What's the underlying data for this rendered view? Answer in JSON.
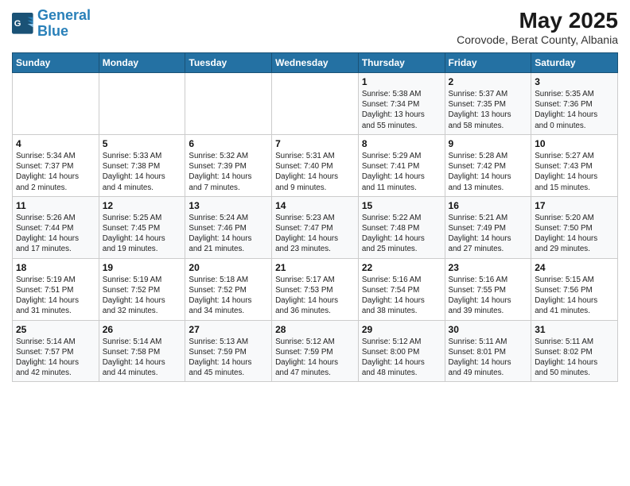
{
  "logo": {
    "line1": "General",
    "line2": "Blue"
  },
  "title": "May 2025",
  "subtitle": "Corovode, Berat County, Albania",
  "days_of_week": [
    "Sunday",
    "Monday",
    "Tuesday",
    "Wednesday",
    "Thursday",
    "Friday",
    "Saturday"
  ],
  "weeks": [
    [
      {
        "day": "",
        "info": ""
      },
      {
        "day": "",
        "info": ""
      },
      {
        "day": "",
        "info": ""
      },
      {
        "day": "",
        "info": ""
      },
      {
        "day": "1",
        "info": "Sunrise: 5:38 AM\nSunset: 7:34 PM\nDaylight: 13 hours\nand 55 minutes."
      },
      {
        "day": "2",
        "info": "Sunrise: 5:37 AM\nSunset: 7:35 PM\nDaylight: 13 hours\nand 58 minutes."
      },
      {
        "day": "3",
        "info": "Sunrise: 5:35 AM\nSunset: 7:36 PM\nDaylight: 14 hours\nand 0 minutes."
      }
    ],
    [
      {
        "day": "4",
        "info": "Sunrise: 5:34 AM\nSunset: 7:37 PM\nDaylight: 14 hours\nand 2 minutes."
      },
      {
        "day": "5",
        "info": "Sunrise: 5:33 AM\nSunset: 7:38 PM\nDaylight: 14 hours\nand 4 minutes."
      },
      {
        "day": "6",
        "info": "Sunrise: 5:32 AM\nSunset: 7:39 PM\nDaylight: 14 hours\nand 7 minutes."
      },
      {
        "day": "7",
        "info": "Sunrise: 5:31 AM\nSunset: 7:40 PM\nDaylight: 14 hours\nand 9 minutes."
      },
      {
        "day": "8",
        "info": "Sunrise: 5:29 AM\nSunset: 7:41 PM\nDaylight: 14 hours\nand 11 minutes."
      },
      {
        "day": "9",
        "info": "Sunrise: 5:28 AM\nSunset: 7:42 PM\nDaylight: 14 hours\nand 13 minutes."
      },
      {
        "day": "10",
        "info": "Sunrise: 5:27 AM\nSunset: 7:43 PM\nDaylight: 14 hours\nand 15 minutes."
      }
    ],
    [
      {
        "day": "11",
        "info": "Sunrise: 5:26 AM\nSunset: 7:44 PM\nDaylight: 14 hours\nand 17 minutes."
      },
      {
        "day": "12",
        "info": "Sunrise: 5:25 AM\nSunset: 7:45 PM\nDaylight: 14 hours\nand 19 minutes."
      },
      {
        "day": "13",
        "info": "Sunrise: 5:24 AM\nSunset: 7:46 PM\nDaylight: 14 hours\nand 21 minutes."
      },
      {
        "day": "14",
        "info": "Sunrise: 5:23 AM\nSunset: 7:47 PM\nDaylight: 14 hours\nand 23 minutes."
      },
      {
        "day": "15",
        "info": "Sunrise: 5:22 AM\nSunset: 7:48 PM\nDaylight: 14 hours\nand 25 minutes."
      },
      {
        "day": "16",
        "info": "Sunrise: 5:21 AM\nSunset: 7:49 PM\nDaylight: 14 hours\nand 27 minutes."
      },
      {
        "day": "17",
        "info": "Sunrise: 5:20 AM\nSunset: 7:50 PM\nDaylight: 14 hours\nand 29 minutes."
      }
    ],
    [
      {
        "day": "18",
        "info": "Sunrise: 5:19 AM\nSunset: 7:51 PM\nDaylight: 14 hours\nand 31 minutes."
      },
      {
        "day": "19",
        "info": "Sunrise: 5:19 AM\nSunset: 7:52 PM\nDaylight: 14 hours\nand 32 minutes."
      },
      {
        "day": "20",
        "info": "Sunrise: 5:18 AM\nSunset: 7:52 PM\nDaylight: 14 hours\nand 34 minutes."
      },
      {
        "day": "21",
        "info": "Sunrise: 5:17 AM\nSunset: 7:53 PM\nDaylight: 14 hours\nand 36 minutes."
      },
      {
        "day": "22",
        "info": "Sunrise: 5:16 AM\nSunset: 7:54 PM\nDaylight: 14 hours\nand 38 minutes."
      },
      {
        "day": "23",
        "info": "Sunrise: 5:16 AM\nSunset: 7:55 PM\nDaylight: 14 hours\nand 39 minutes."
      },
      {
        "day": "24",
        "info": "Sunrise: 5:15 AM\nSunset: 7:56 PM\nDaylight: 14 hours\nand 41 minutes."
      }
    ],
    [
      {
        "day": "25",
        "info": "Sunrise: 5:14 AM\nSunset: 7:57 PM\nDaylight: 14 hours\nand 42 minutes."
      },
      {
        "day": "26",
        "info": "Sunrise: 5:14 AM\nSunset: 7:58 PM\nDaylight: 14 hours\nand 44 minutes."
      },
      {
        "day": "27",
        "info": "Sunrise: 5:13 AM\nSunset: 7:59 PM\nDaylight: 14 hours\nand 45 minutes."
      },
      {
        "day": "28",
        "info": "Sunrise: 5:12 AM\nSunset: 7:59 PM\nDaylight: 14 hours\nand 47 minutes."
      },
      {
        "day": "29",
        "info": "Sunrise: 5:12 AM\nSunset: 8:00 PM\nDaylight: 14 hours\nand 48 minutes."
      },
      {
        "day": "30",
        "info": "Sunrise: 5:11 AM\nSunset: 8:01 PM\nDaylight: 14 hours\nand 49 minutes."
      },
      {
        "day": "31",
        "info": "Sunrise: 5:11 AM\nSunset: 8:02 PM\nDaylight: 14 hours\nand 50 minutes."
      }
    ]
  ]
}
